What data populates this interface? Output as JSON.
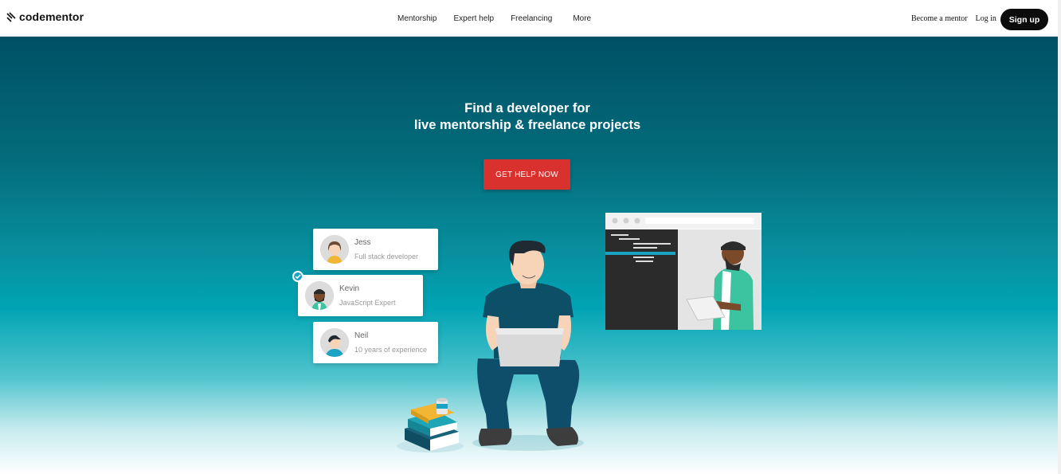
{
  "nav": {
    "logo_text": "codementor",
    "menu": [
      "Mentorship",
      "Expert help",
      "Freelancing",
      "More"
    ],
    "become_mentor": "Become a mentor",
    "login": "Log in",
    "signup": "Sign up"
  },
  "hero": {
    "headline_line1": "Find a developer for",
    "headline_line2": "live mentorship & freelance projects",
    "cta": "GET HELP NOW"
  },
  "mentors": [
    {
      "name": "Jess",
      "role": "Full stack developer"
    },
    {
      "name": "Kevin",
      "role": "JavaScript Expert"
    },
    {
      "name": "Neil",
      "role": "10 years of experience"
    }
  ],
  "colors": {
    "cta": "#d9312d",
    "signup_bg": "#0c0c0c",
    "hero_top": "#005064",
    "hero_mid": "#00a4b4",
    "check": "#1aa3c3"
  }
}
